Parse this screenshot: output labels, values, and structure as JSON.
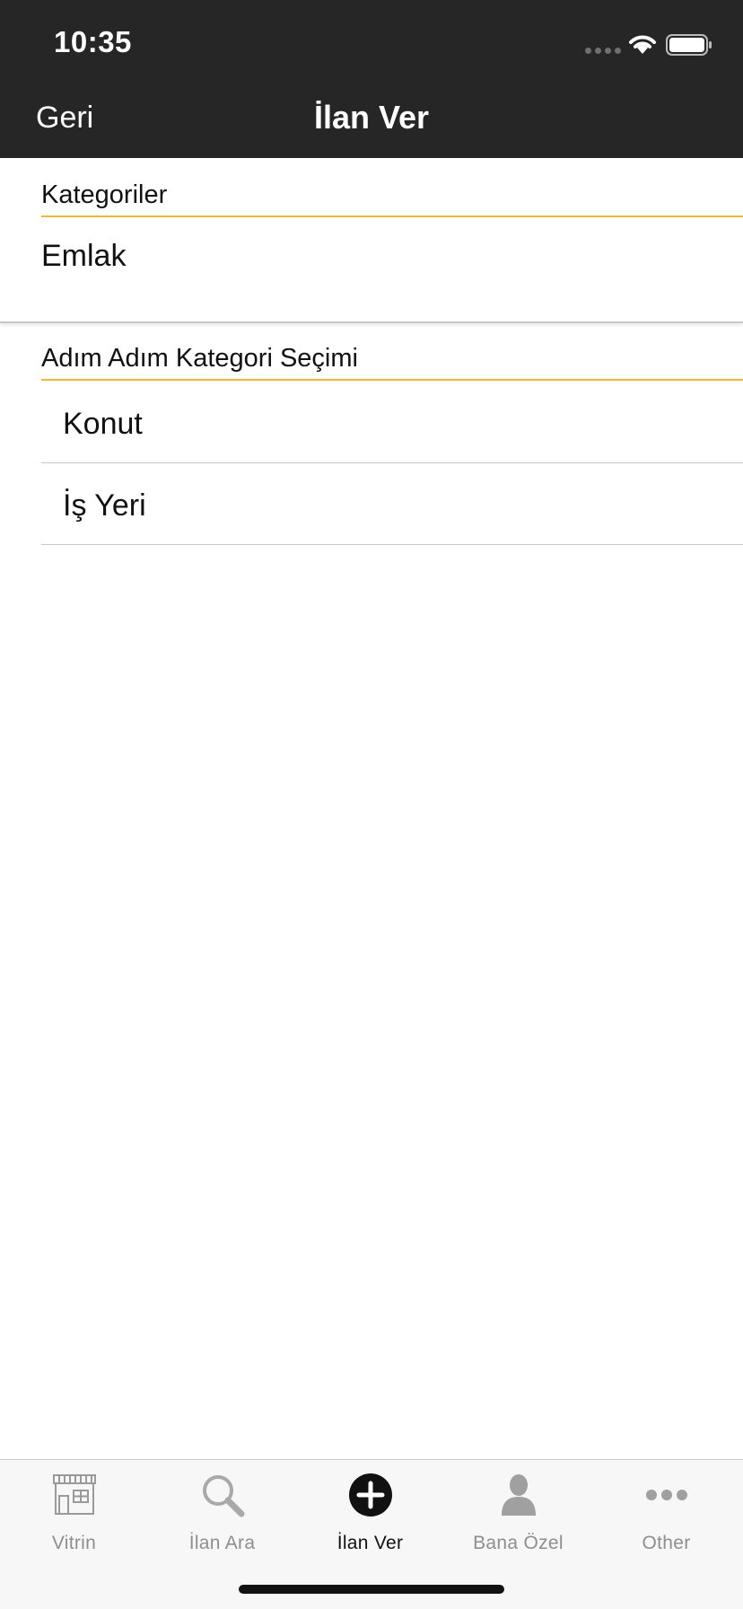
{
  "status_bar": {
    "time": "10:35"
  },
  "nav": {
    "back_label": "Geri",
    "title": "İlan Ver"
  },
  "categories_section": {
    "header": "Kategoriler",
    "selected": "Emlak"
  },
  "step_section": {
    "header": "Adım Adım Kategori Seçimi",
    "items": [
      {
        "label": "Konut"
      },
      {
        "label": "İş Yeri"
      }
    ]
  },
  "tabs": [
    {
      "label": "Vitrin",
      "icon": "storefront-icon",
      "active": false
    },
    {
      "label": "İlan Ara",
      "icon": "search-icon",
      "active": false
    },
    {
      "label": "İlan Ver",
      "icon": "plus-circle-icon",
      "active": true
    },
    {
      "label": "Bana Özel",
      "icon": "person-icon",
      "active": false
    },
    {
      "label": "Other",
      "icon": "more-icon",
      "active": false
    }
  ],
  "colors": {
    "bar": "#262626",
    "accent": "#f2b632",
    "inactive": "#8e8e8e"
  }
}
